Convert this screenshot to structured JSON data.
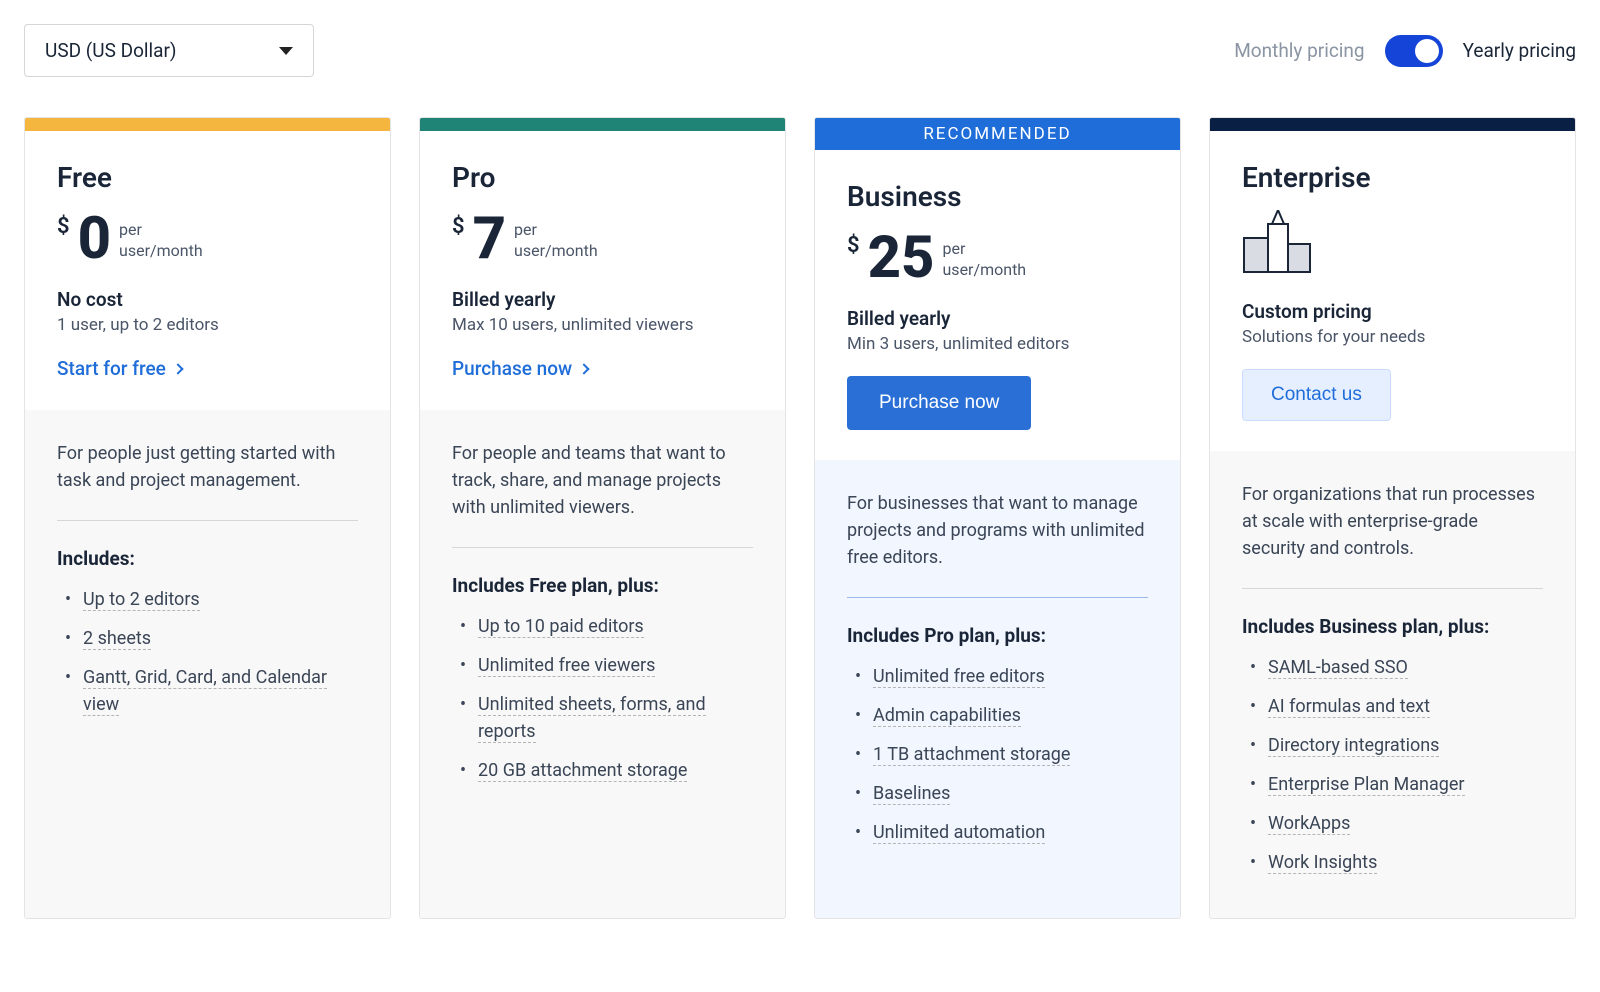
{
  "header": {
    "currency": "USD (US Dollar)",
    "monthly_label": "Monthly pricing",
    "yearly_label": "Yearly pricing"
  },
  "plans": {
    "free": {
      "name": "Free",
      "currency_symbol": "$",
      "price": "0",
      "per1": "per",
      "per2": "user/month",
      "sub1": "No cost",
      "sub2": "1 user, up to 2 editors",
      "cta": "Start for free",
      "desc": "For people just getting started with task and project management.",
      "includes_title": "Includes:",
      "features": [
        "Up to 2 editors",
        "2 sheets",
        "Gantt, Grid, Card, and Calendar view"
      ]
    },
    "pro": {
      "name": "Pro",
      "currency_symbol": "$",
      "price": "7",
      "per1": "per",
      "per2": "user/month",
      "sub1": "Billed yearly",
      "sub2": "Max 10 users, unlimited viewers",
      "cta": "Purchase now",
      "desc": "For people and teams that want to track, share, and manage projects with unlimited viewers.",
      "includes_title": "Includes Free plan, plus:",
      "features": [
        "Up to 10 paid editors",
        "Unlimited free viewers",
        "Unlimited sheets, forms, and reports",
        "20 GB attachment storage"
      ]
    },
    "business": {
      "badge": "RECOMMENDED",
      "name": "Business",
      "currency_symbol": "$",
      "price": "25",
      "per1": "per",
      "per2": "user/month",
      "sub1": "Billed yearly",
      "sub2": "Min 3 users, unlimited editors",
      "cta": "Purchase now",
      "desc": "For businesses that want to manage projects and programs with unlimited free editors.",
      "includes_title": "Includes Pro plan, plus:",
      "features": [
        "Unlimited free editors",
        "Admin capabilities",
        "1 TB attachment storage",
        "Baselines",
        "Unlimited automation"
      ]
    },
    "enterprise": {
      "name": "Enterprise",
      "sub1": "Custom pricing",
      "sub2": "Solutions for your needs",
      "cta": "Contact us",
      "desc": "For organizations that run processes at scale with enterprise-grade security and controls.",
      "includes_title": "Includes Business plan, plus:",
      "features": [
        "SAML-based SSO",
        "AI formulas and text",
        "Directory integrations",
        "Enterprise Plan Manager",
        "WorkApps",
        "Work Insights"
      ]
    }
  }
}
